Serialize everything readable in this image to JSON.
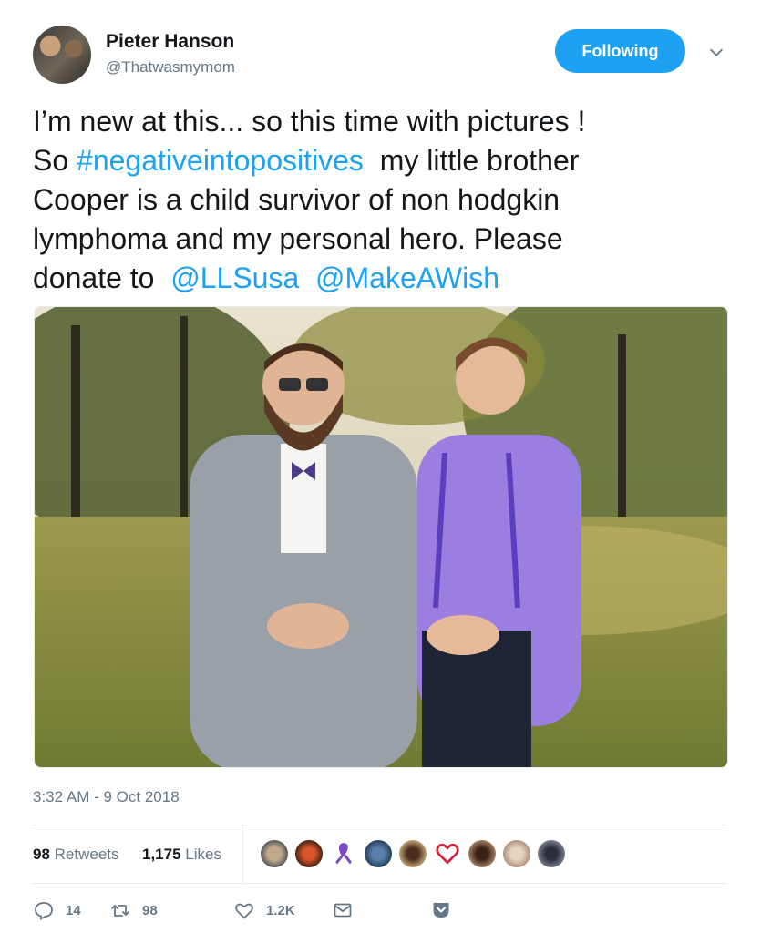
{
  "author": {
    "name": "Pieter Hanson",
    "handle": "@Thatwasmymom"
  },
  "follow_button": {
    "label": "Following"
  },
  "tweet": {
    "line1": "I’m new at this... so this time with pictures !",
    "line2_prefix": "So ",
    "hashtag": "#negativeintopositives",
    "line2_suffix": "  my little brother",
    "line3": "Cooper is a child survivor of non hodgkin",
    "line4": "lymphoma and my personal hero. Please",
    "line5_prefix": "donate to  ",
    "mention1": "@LLSusa",
    "mention_gap": "  ",
    "mention2": "@MakeAWish"
  },
  "timestamp": "3:32 AM - 9 Oct 2018",
  "stats": {
    "retweets_count": "98",
    "retweets_label": "Retweets",
    "likes_count": "1,175",
    "likes_label": "Likes"
  },
  "actions": {
    "reply_count": "14",
    "retweet_count": "98",
    "like_count": "1.2K"
  },
  "colors": {
    "accent": "#1da1f2",
    "text": "#14171a",
    "muted": "#657786",
    "border": "#e6ecf0"
  },
  "icons": [
    "chevron-down-icon",
    "reply-icon",
    "retweet-icon",
    "heart-icon",
    "envelope-icon",
    "share-icon"
  ]
}
